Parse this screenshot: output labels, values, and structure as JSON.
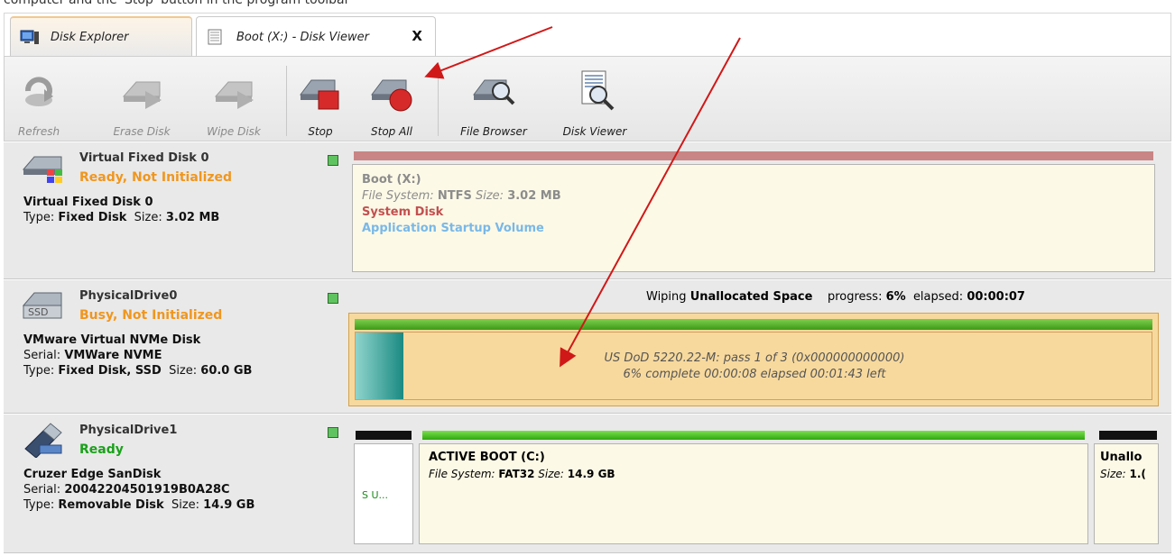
{
  "caption": "computer and the 'Stop' button in the program toolbar",
  "tabs": [
    {
      "label": "Disk Explorer",
      "active": true
    },
    {
      "label": "Boot (X:) - Disk Viewer",
      "active": false,
      "close": "X"
    }
  ],
  "toolbar": {
    "refresh": "Refresh",
    "erase_disk": "Erase Disk",
    "wipe_disk": "Wipe Disk",
    "stop": "Stop",
    "stop_all": "Stop All",
    "file_browser": "File Browser",
    "disk_viewer": "Disk Viewer"
  },
  "disks": [
    {
      "name": "Virtual Fixed Disk 0",
      "status": "Ready, Not Initialized",
      "model": "Virtual Fixed Disk 0",
      "type_label": "Type:",
      "type": "Fixed Disk",
      "size_label": "Size:",
      "size": "3.02 MB",
      "partition": {
        "title": "Boot (X:)",
        "fs_label": "File System:",
        "fs": "NTFS",
        "size_label": "Size:",
        "size": "3.02 MB",
        "flag1": "System Disk",
        "flag2": "Application Startup Volume"
      }
    },
    {
      "name": "PhysicalDrive0",
      "status": "Busy, Not Initialized",
      "model": "VMware Virtual NVMe Disk",
      "serial_label": "Serial:",
      "serial": "VMWare NVME",
      "type_label": "Type:",
      "type": "Fixed Disk, SSD",
      "size_label": "Size:",
      "size": "60.0 GB",
      "wipe": {
        "prefix": "Wiping",
        "target": "Unallocated Space",
        "progress_label": "progress:",
        "progress": "6%",
        "progress_value": 0.06,
        "elapsed_label": "elapsed:",
        "elapsed": "00:00:07",
        "line1": "US DoD 5220.22-M: pass 1 of 3 (0x000000000000)",
        "line2": "6% complete  00:00:08 elapsed   00:01:43 left"
      }
    },
    {
      "name": "PhysicalDrive1",
      "status": "Ready",
      "model": "Cruzer Edge SanDisk",
      "serial_label": "Serial:",
      "serial": "20042204501919B0A28C",
      "type_label": "Type:",
      "type": "Removable Disk",
      "size_label": "Size:",
      "size": "14.9 GB",
      "small_part": "S U...",
      "partition": {
        "title": "ACTIVE BOOT (C:)",
        "fs_label": "File System:",
        "fs": "FAT32",
        "size_label": "Size:",
        "size": "14.9 GB"
      },
      "unalloc": {
        "title": "Unallo",
        "size_label": "Size:",
        "size": "1.("
      }
    }
  ],
  "colors": {
    "status_orange": "#f0961e",
    "status_green": "#1aa11a",
    "arrow_red": "#d01818",
    "wipe_fill": "#f9dc9c",
    "progress_green": "#4cb32c"
  }
}
